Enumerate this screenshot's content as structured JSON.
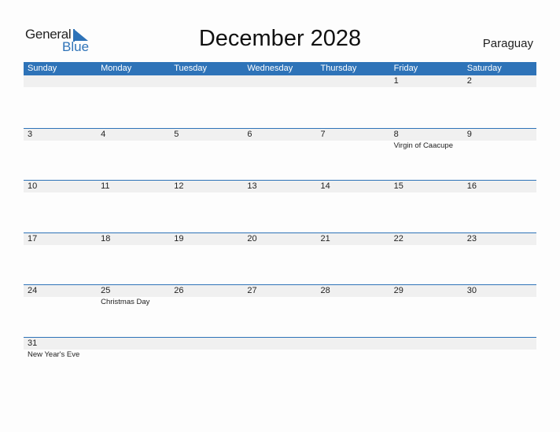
{
  "logo": {
    "line1": "General",
    "line2": "Blue"
  },
  "header": {
    "title": "December 2028",
    "country": "Paraguay"
  },
  "colors": {
    "accent": "#2e73b8",
    "band": "#f0f0f0"
  },
  "weekdays": [
    "Sunday",
    "Monday",
    "Tuesday",
    "Wednesday",
    "Thursday",
    "Friday",
    "Saturday"
  ],
  "weeks": [
    [
      {
        "day": "",
        "event": ""
      },
      {
        "day": "",
        "event": ""
      },
      {
        "day": "",
        "event": ""
      },
      {
        "day": "",
        "event": ""
      },
      {
        "day": "",
        "event": ""
      },
      {
        "day": "1",
        "event": ""
      },
      {
        "day": "2",
        "event": ""
      }
    ],
    [
      {
        "day": "3",
        "event": ""
      },
      {
        "day": "4",
        "event": ""
      },
      {
        "day": "5",
        "event": ""
      },
      {
        "day": "6",
        "event": ""
      },
      {
        "day": "7",
        "event": ""
      },
      {
        "day": "8",
        "event": "Virgin of Caacupe"
      },
      {
        "day": "9",
        "event": ""
      }
    ],
    [
      {
        "day": "10",
        "event": ""
      },
      {
        "day": "11",
        "event": ""
      },
      {
        "day": "12",
        "event": ""
      },
      {
        "day": "13",
        "event": ""
      },
      {
        "day": "14",
        "event": ""
      },
      {
        "day": "15",
        "event": ""
      },
      {
        "day": "16",
        "event": ""
      }
    ],
    [
      {
        "day": "17",
        "event": ""
      },
      {
        "day": "18",
        "event": ""
      },
      {
        "day": "19",
        "event": ""
      },
      {
        "day": "20",
        "event": ""
      },
      {
        "day": "21",
        "event": ""
      },
      {
        "day": "22",
        "event": ""
      },
      {
        "day": "23",
        "event": ""
      }
    ],
    [
      {
        "day": "24",
        "event": ""
      },
      {
        "day": "25",
        "event": "Christmas Day"
      },
      {
        "day": "26",
        "event": ""
      },
      {
        "day": "27",
        "event": ""
      },
      {
        "day": "28",
        "event": ""
      },
      {
        "day": "29",
        "event": ""
      },
      {
        "day": "30",
        "event": ""
      }
    ],
    [
      {
        "day": "31",
        "event": "New Year's Eve"
      },
      {
        "day": "",
        "event": ""
      },
      {
        "day": "",
        "event": ""
      },
      {
        "day": "",
        "event": ""
      },
      {
        "day": "",
        "event": ""
      },
      {
        "day": "",
        "event": ""
      },
      {
        "day": "",
        "event": ""
      }
    ]
  ]
}
